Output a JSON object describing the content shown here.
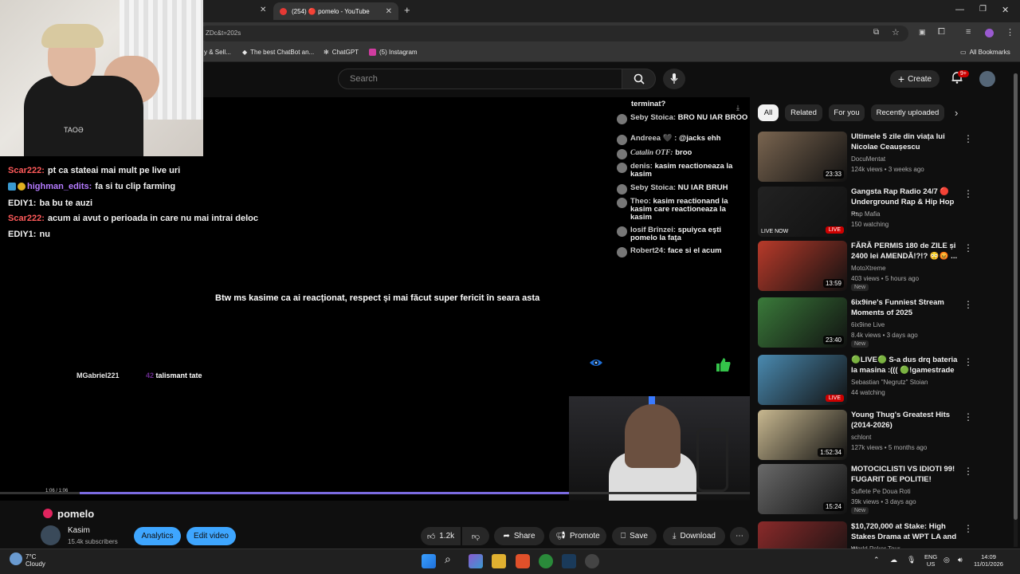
{
  "browser": {
    "tabs": [
      {
        "label": "(254) 🔴 pomelo - YouTube",
        "active": true
      }
    ],
    "url": "ZDc&t=202s",
    "bookmarks": [
      {
        "label": "y & Sell..."
      },
      {
        "label": "The best ChatBot an..."
      },
      {
        "label": "ChatGPT"
      },
      {
        "label": "(5) Instagram"
      }
    ],
    "all_bookmarks": "All Bookmarks"
  },
  "header": {
    "search_placeholder": "Search",
    "create_label": "Create",
    "notif_count": "9+"
  },
  "webcam": {
    "shirt_text": "TAOƏ"
  },
  "overlay_chat_left": [
    {
      "user": "Scar222:",
      "color": "#ff5a5a",
      "text": "pt ca stateai mai mult pe live uri"
    },
    {
      "user": "highman_edits:",
      "color": "#b57bff",
      "text": "fa si tu clip farming"
    },
    {
      "user": "EDIY1:",
      "color": "#f1f1f1",
      "text": "ba bu te auzi"
    },
    {
      "user": "Scar222:",
      "color": "#ff5a5a",
      "text": "acum ai avut o perioada in care nu mai intrai deloc"
    },
    {
      "user": "EDIY1:",
      "color": "#f1f1f1",
      "text": "nu"
    }
  ],
  "overlay_chat_right": [
    {
      "user": "",
      "text": "terminat?"
    },
    {
      "user": "Seby Stoica:",
      "text": "BRO NU IAR BROO"
    },
    {
      "user": "Andreea 🖤 :",
      "text": "@jacks ehh"
    },
    {
      "user": "Catalin OTF:",
      "text": "broo"
    },
    {
      "user": "denis:",
      "text": "kasim reactioneaza la kasim"
    },
    {
      "user": "Seby Stoica:",
      "text": "NU IAR BRUH"
    },
    {
      "user": "Theo:",
      "text": "kasim reactionand la kasim care reactioneaza la kasim"
    },
    {
      "user": "Iosif Brînzei:",
      "text": "spuiyca eşti pomelo la faţa"
    },
    {
      "user": "Robert24:",
      "text": "face si el acum"
    }
  ],
  "caption": "Btw ms kasime ca ai reacționat, respect și mai făcut super fericit în seara asta",
  "donation": {
    "user": "MGabriel221",
    "amount": "42",
    "text": "talismant tate"
  },
  "player": {
    "time": "1:06 / 1:06",
    "progress_fraction": 0.73
  },
  "video": {
    "title": "pomelo",
    "channel": "Kasim",
    "subscribers": "15.4k subscribers",
    "analytics": "Analytics",
    "edit": "Edit video",
    "likes": "1.2k",
    "share": "Share",
    "promote": "Promote",
    "save": "Save",
    "download": "Download"
  },
  "chips": [
    "All",
    "Related",
    "For you",
    "Recently uploaded"
  ],
  "recommendations": [
    {
      "title": "Ultimele 5 zile din viața lui Nicolae Ceaușescu",
      "channel": "DocuMentat",
      "meta": "124k views • 3 weeks ago",
      "duration": "23:33",
      "thumb_color": "#7a6550",
      "badge": ""
    },
    {
      "title": "Gangsta Rap Radio 24/7 🔴 Underground Rap & Hip Hop ...",
      "channel": "Rap Mafia",
      "meta": "150 watching",
      "duration": "",
      "live": "LIVE",
      "thumb_color": "#222222",
      "badge": "LIVE NOW"
    },
    {
      "title": "FĂRĂ PERMIS 180 de ZILE și 2400 lei AMENDĂ!?!? 😳😡 ...",
      "channel": "MotoXtreme",
      "meta": "403 views • 5 hours ago",
      "duration": "13:59",
      "thumb_color": "#b83a2a",
      "badge": "New"
    },
    {
      "title": "6ix9ine's Funniest Stream Moments of 2025",
      "channel": "6ix9ine Live",
      "meta": "8.4k views • 3 days ago",
      "duration": "23:40",
      "thumb_color": "#3a7a3a",
      "badge": "New"
    },
    {
      "title": "🟢LIVE🟢 S-a dus drq bateria la masina :((( 🟢!gamestrade",
      "channel": "Sebastian \"Negrutz\" Stoian",
      "meta": "44 watching",
      "duration": "",
      "live": "LIVE",
      "thumb_color": "#4a8ab0",
      "badge": ""
    },
    {
      "title": "Young Thug's Greatest Hits (2014-2026)",
      "channel": "schlont",
      "meta": "127k views • 5 months ago",
      "duration": "1:52:34",
      "thumb_color": "#c8b890",
      "badge": ""
    },
    {
      "title": "MOTOCICLISTI VS IDIOTI 99! FUGARIT DE POLITIE!",
      "channel": "Suflete Pe Doua Roti",
      "meta": "39k views • 3 days ago",
      "duration": "15:24",
      "thumb_color": "#6a6a6a",
      "badge": "New"
    },
    {
      "title": "$10,720,000 at Stake: High Stakes Drama at WPT LA and ...",
      "channel": "World Poker Tour",
      "meta": "",
      "duration": "",
      "thumb_color": "#8a2a2a",
      "badge": ""
    }
  ],
  "taskbar": {
    "temp": "7°C",
    "weather": "Cloudy",
    "lang1": "ENG",
    "lang2": "US",
    "time": "14:09",
    "date": "11/01/2026"
  }
}
